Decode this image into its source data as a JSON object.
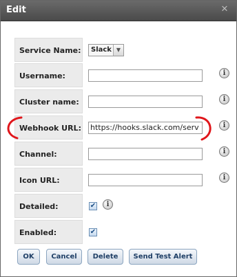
{
  "window": {
    "title": "Edit",
    "close_glyph": "✕"
  },
  "form": {
    "service_name": {
      "label": "Service Name:",
      "value": "Slack"
    },
    "username": {
      "label": "Username:",
      "value": ""
    },
    "cluster_name": {
      "label": "Cluster name:",
      "value": ""
    },
    "webhook_url": {
      "label": "Webhook URL:",
      "value": "https://hooks.slack.com/serv"
    },
    "channel": {
      "label": "Channel:",
      "value": ""
    },
    "icon_url": {
      "label": "Icon URL:",
      "value": ""
    },
    "detailed": {
      "label": "Detailed:",
      "checked": true
    },
    "enabled": {
      "label": "Enabled:",
      "checked": true
    }
  },
  "info_glyph": "i",
  "buttons": {
    "ok": "OK",
    "cancel": "Cancel",
    "delete": "Delete",
    "send_test_alert": "Send Test Alert"
  },
  "annotation": {
    "color": "#e0161b"
  }
}
